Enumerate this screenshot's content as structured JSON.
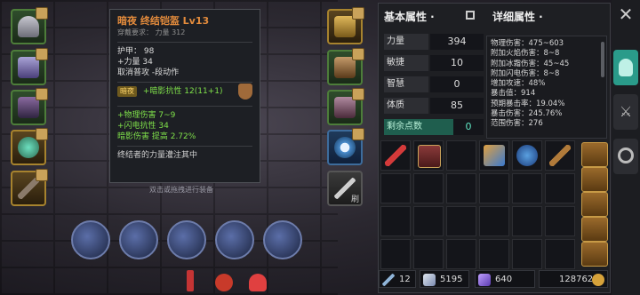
{
  "tooltip": {
    "title": "暗夜 终结铠盔 Lv13",
    "requirement": "穿戴要求：  力量 312",
    "stats": [
      "护甲： 98",
      "+力量 34",
      "取消普攻 -段动作"
    ],
    "set_chip": "暗夜",
    "set_bonus": "+暗影抗性 12(11+1)",
    "affixes": [
      "+物理伤害 7~9",
      "+闪电抗性 34",
      "暗影伤害 提高 2.72%"
    ],
    "flavor": "终结者的力量灌注其中"
  },
  "hint": "双击或拖拽进行装备",
  "equip_right_label": "刷",
  "panel": {
    "basic_header": "基本属性 ·",
    "detail_header": "详细属性 ·",
    "attributes": [
      {
        "label": "力量",
        "value": "394"
      },
      {
        "label": "敏捷",
        "value": "10"
      },
      {
        "label": "智慧",
        "value": "0"
      },
      {
        "label": "体质",
        "value": "85"
      }
    ],
    "remaining": {
      "label": "剩余点数",
      "value": "0"
    },
    "details": [
      "物理伤害：475~603",
      "附加火焰伤害：8~8",
      "附加冰霜伤害：45~45",
      "附加闪电伤害：8~8",
      "增加攻速：48%",
      "暴击值：914",
      "预期暴击率：19.04%",
      "暴击伤害：245.76%",
      "范围伤害：276"
    ]
  },
  "resources": {
    "level": "12",
    "crystal": "5195",
    "gem": "640",
    "gold": "128762"
  },
  "colors": {
    "accent": "#5fe7c3",
    "gold": "#c9a25a",
    "title": "#e38b3c"
  }
}
